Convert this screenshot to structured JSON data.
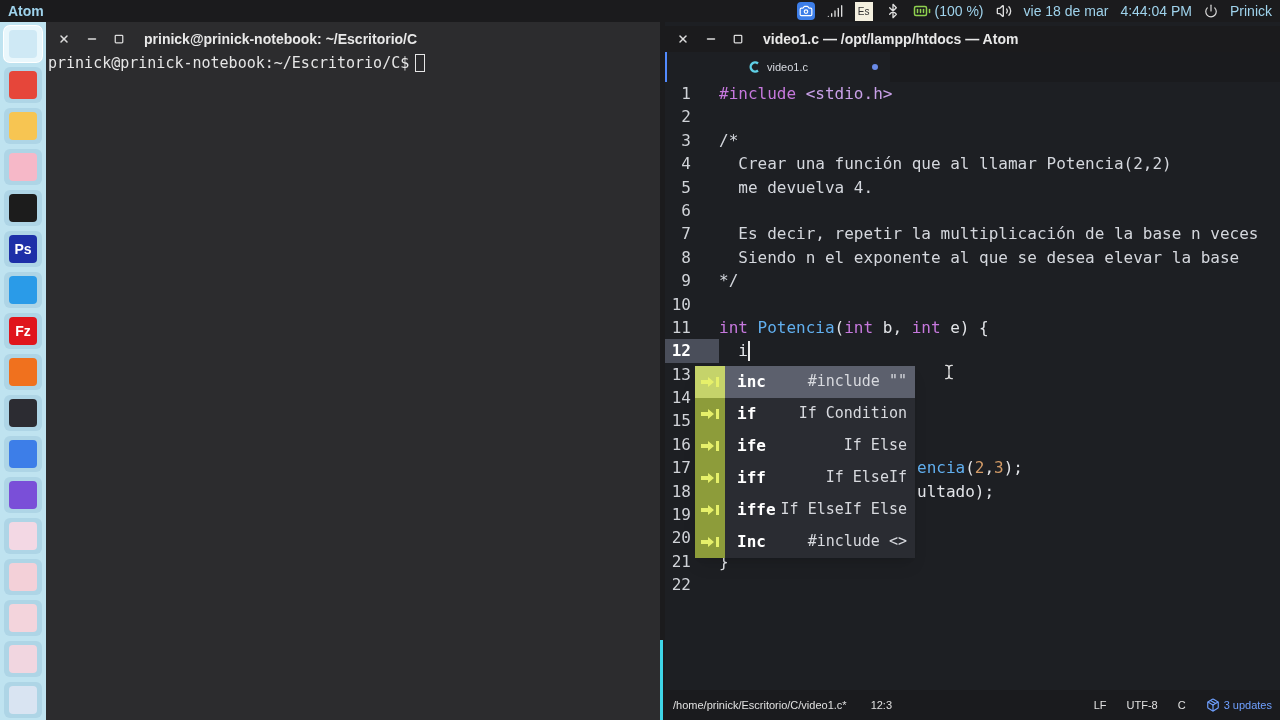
{
  "top_bar": {
    "app_name": "Atom",
    "keyboard": "Es",
    "battery": "(100 %)",
    "date": "vie 18 de mar",
    "time": "4:44:04 PM",
    "user": "Prinick"
  },
  "launcher": {
    "items": [
      {
        "color": "#cfe9f5",
        "selected": true
      },
      {
        "color": "#e6463a",
        "selected": false
      },
      {
        "color": "#f7c552",
        "selected": false
      },
      {
        "color": "#f6b8c8",
        "selected": false
      },
      {
        "color": "#1c1c1c",
        "selected": false
      },
      {
        "color": "#1d2fa8",
        "label": "Ps",
        "selected": false
      },
      {
        "color": "#2a9be8",
        "selected": false
      },
      {
        "color": "#e0151c",
        "label": "Fz",
        "selected": false
      },
      {
        "color": "#f0711e",
        "selected": false
      },
      {
        "color": "#2c2c32",
        "selected": false
      },
      {
        "color": "#3d7ee8",
        "selected": false
      },
      {
        "color": "#7a4fd8",
        "selected": false
      },
      {
        "color": "#f3d8e4",
        "selected": false
      },
      {
        "color": "#f3d0d8",
        "selected": false
      },
      {
        "color": "#f3d4dc",
        "selected": false
      },
      {
        "color": "#f1d6e0",
        "selected": false
      },
      {
        "color": "#d9e4f2",
        "selected": false
      }
    ]
  },
  "terminal": {
    "title": "prinick@prinick-notebook: ~/Escritorio/C",
    "prompt": "prinick@prinick-notebook:~/Escritorio/C$"
  },
  "editor": {
    "title": "video1.c — /opt/lampp/htdocs — Atom",
    "tabs": [
      {
        "label": "video1.c",
        "selected": true,
        "modified": true
      }
    ],
    "lines": [
      {
        "number": "1",
        "current": false,
        "tokens": [
          {
            "text": "#include",
            "kind": "keyword"
          },
          {
            "text": " <stdio.h>",
            "kind": "string"
          }
        ]
      },
      {
        "number": "2",
        "current": false
      },
      {
        "number": "3",
        "current": false,
        "tokens": [
          {
            "text": "/*",
            "kind": "comment"
          }
        ]
      },
      {
        "number": "4",
        "current": false,
        "tokens": [
          {
            "text": "  Crear una función que al llamar Potencia(2,2)",
            "kind": "comment"
          }
        ]
      },
      {
        "number": "5",
        "current": false,
        "tokens": [
          {
            "text": "  me devuelva 4.",
            "kind": "comment"
          }
        ]
      },
      {
        "number": "6",
        "current": false
      },
      {
        "number": "7",
        "current": false,
        "tokens": [
          {
            "text": "  Es decir, repetir la multiplicación de la base n veces",
            "kind": "comment"
          }
        ]
      },
      {
        "number": "8",
        "current": false,
        "tokens": [
          {
            "text": "  Siendo n el exponente al que se desea elevar la base",
            "kind": "comment"
          }
        ]
      },
      {
        "number": "9",
        "current": false,
        "tokens": [
          {
            "text": "*/",
            "kind": "comment"
          }
        ]
      },
      {
        "number": "10",
        "current": false
      },
      {
        "number": "11",
        "current": false,
        "tokens": [
          {
            "text": "int ",
            "kind": "keyword"
          },
          {
            "text": "Potencia",
            "kind": "function"
          },
          {
            "text": "(",
            "kind": "plain"
          },
          {
            "text": "int",
            "kind": "keyword"
          },
          {
            "text": " b, ",
            "kind": "plain"
          },
          {
            "text": "int",
            "kind": "keyword"
          },
          {
            "text": " e) {",
            "kind": "plain"
          }
        ]
      },
      {
        "number": "12",
        "current": true,
        "tokens": [
          {
            "text": "  i",
            "kind": "plain"
          }
        ]
      },
      {
        "number": "13",
        "current": false
      },
      {
        "number": "14",
        "current": false
      },
      {
        "number": "15",
        "current": false
      },
      {
        "number": "16",
        "current": false
      },
      {
        "number": "17",
        "current": false,
        "partial": true,
        "tokens": [
          {
            "text": "encia",
            "kind": "function"
          },
          {
            "text": "(",
            "kind": "plain"
          },
          {
            "text": "2",
            "kind": "number"
          },
          {
            "text": ",",
            "kind": "plain"
          },
          {
            "text": "3",
            "kind": "number"
          },
          {
            "text": ");",
            "kind": "plain"
          }
        ]
      },
      {
        "number": "18",
        "current": false,
        "partial": true,
        "tokens": [
          {
            "text": "ultado);",
            "kind": "plain"
          }
        ]
      },
      {
        "number": "19",
        "current": false
      },
      {
        "number": "20",
        "current": false
      },
      {
        "number": "21",
        "current": false,
        "tokens": [
          {
            "text": "}",
            "kind": "plain"
          }
        ]
      },
      {
        "number": "22",
        "current": false
      }
    ],
    "autocomplete": [
      {
        "snippet": "inc",
        "description": "#include \"\"",
        "selected": true
      },
      {
        "snippet": "if",
        "description": "If Condition",
        "selected": false
      },
      {
        "snippet": "ife",
        "description": "If Else",
        "selected": false
      },
      {
        "snippet": "iff",
        "description": "If ElseIf",
        "selected": false
      },
      {
        "snippet": "iffe",
        "description": "If ElseIf Else",
        "selected": false
      },
      {
        "snippet": "Inc",
        "description": "#include <>",
        "selected": false
      }
    ],
    "status_bar": {
      "path": "/home/prinick/Escritorio/C/video1.c*",
      "cursor": "12:3",
      "line_ending": "LF",
      "encoding": "UTF-8",
      "grammar": "C",
      "updates": "3 updates"
    }
  }
}
